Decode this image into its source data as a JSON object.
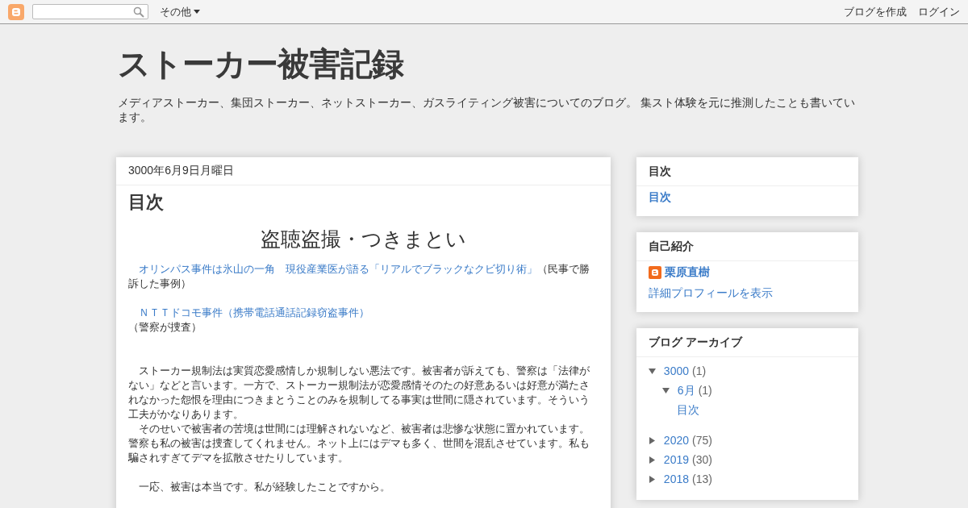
{
  "navbar": {
    "more_menu": "その他",
    "create_blog": "ブログを作成",
    "login": "ログイン"
  },
  "header": {
    "title": "ストーカー被害記録",
    "description": "メディアストーカー、集団ストーカー、ネットストーカー、ガスライティング被害についてのブログ。 集スト体験を元に推測したことも書いています。"
  },
  "post": {
    "date": "3000年6月9日月曜日",
    "title": "目次",
    "section_heading": "盗聴盗撮・つきまとい",
    "entries": [
      {
        "link": "オリンパス事件は氷山の一角　現役産業医が語る「リアルでブラックなクビ切り術」",
        "note": "（民事で勝訴した事例）",
        "note_on_new_line": false
      },
      {
        "link": "ＮＴＴドコモ事件（携帯電話通話記録窃盗事件）",
        "note": "（警察が捜査）",
        "note_on_new_line": true
      }
    ],
    "paragraph_groups": [
      [
        "ストーカー規制法は実質恋愛感情しか規制しない悪法です。被害者が訴えても、警察は「法律がない」などと言います。一方で、ストーカー規制法が恋愛感情そのたの好意あるいは好意が満たされなかった怨恨を理由につきまとうことのみを規制してる事実は世間に隠されています。そういう工夫がかなりあります。",
        "そのせいで被害者の苦境は世間には理解されないなど、被害者は悲惨な状態に置かれています。警察も私の被害は捜査してくれません。ネット上にはデマも多く、世間を混乱させています。私も騙されすぎてデマを拡散させたりしています。"
      ],
      [
        "一応、被害は本当です。私が経験したことですから。"
      ]
    ]
  },
  "sidebar": {
    "toc": {
      "title": "目次",
      "link": "目次"
    },
    "profile": {
      "title": "自己紹介",
      "name": "栗原直樹",
      "view_profile": "詳細プロフィールを表示"
    },
    "archive": {
      "title": "ブログ アーカイブ",
      "items": [
        {
          "label": "3000",
          "count": "(1)",
          "expanded": true,
          "children": [
            {
              "label": "6月",
              "count": "(1)",
              "expanded": true,
              "posts": [
                "目次"
              ]
            }
          ]
        },
        {
          "label": "2020",
          "count": "(75)",
          "expanded": false
        },
        {
          "label": "2019",
          "count": "(30)",
          "expanded": false
        },
        {
          "label": "2018",
          "count": "(13)",
          "expanded": false
        }
      ]
    }
  }
}
